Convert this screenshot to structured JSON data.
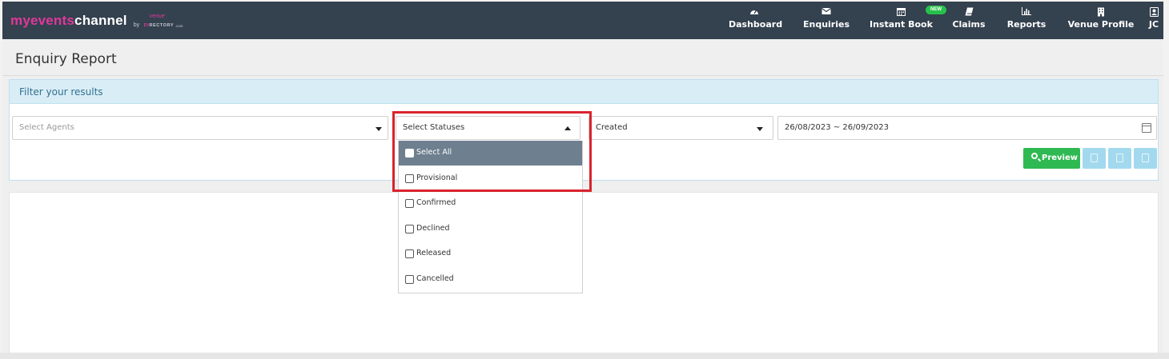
{
  "brand": {
    "logo_pink": "myevents",
    "logo_white": "channel",
    "logo_by": "by",
    "logo_venue": "venue",
    "logo_directory_part1": "DI",
    "logo_directory_part2": "RECTORY",
    "logo_com": ".com"
  },
  "nav": {
    "items": [
      {
        "label": "Dashboard",
        "icon": "dashboard-icon"
      },
      {
        "label": "Enquiries",
        "icon": "envelope-icon"
      },
      {
        "label": "Instant Book",
        "icon": "calendar-icon"
      },
      {
        "label": "Claims",
        "icon": "book-icon"
      },
      {
        "label": "Reports",
        "icon": "bar-chart-icon"
      },
      {
        "label": "Venue Profile",
        "icon": "building-icon"
      },
      {
        "label": "JC",
        "icon": "user-icon"
      }
    ],
    "new_badge": "NEW"
  },
  "page": {
    "title": "Enquiry Report"
  },
  "filters": {
    "header": "Filter your results",
    "agents_placeholder": "Select Agents",
    "statuses_placeholder": "Select Statuses",
    "date_type_value": "Created",
    "date_range_value": "26/08/2023 ~ 26/09/2023",
    "preview_label": "Preview"
  },
  "status_options": [
    {
      "label": "Select All",
      "checked": false,
      "highlighted": true
    },
    {
      "label": "Provisional",
      "checked": false
    },
    {
      "label": "Confirmed",
      "checked": false
    },
    {
      "label": "Declined",
      "checked": false
    },
    {
      "label": "Released",
      "checked": false
    },
    {
      "label": "Cancelled",
      "checked": false
    }
  ],
  "colors": {
    "topbar": "#34414f",
    "brand_pink": "#e0389a",
    "filter_header_bg": "#d9edf7",
    "preview_green": "#2fb952",
    "export_blue": "#a3d9ee",
    "highlight_red": "#d9232d",
    "select_all_bg": "#6e7f8f"
  }
}
